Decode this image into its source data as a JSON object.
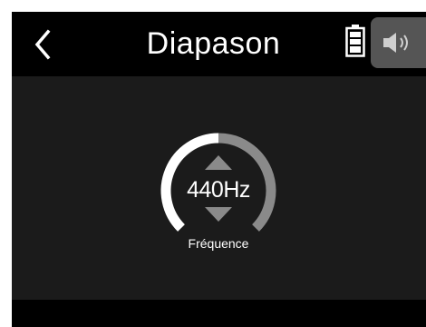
{
  "header": {
    "title": "Diapason",
    "back_icon": "chevron-left-icon",
    "battery_icon": "battery-full-icon",
    "speaker_icon": "speaker-icon"
  },
  "tuner": {
    "frequency": "440Hz",
    "label": "Fréquence",
    "up_icon": "triangle-up-icon",
    "down_icon": "triangle-down-icon"
  },
  "colors": {
    "header_bg": "#000000",
    "screen_bg": "#1b1b1b",
    "arc_active": "#ffffff",
    "arc_inactive": "#8a8a8a",
    "arrow": "#8a8a8a",
    "speaker_button_bg": "#555555"
  }
}
